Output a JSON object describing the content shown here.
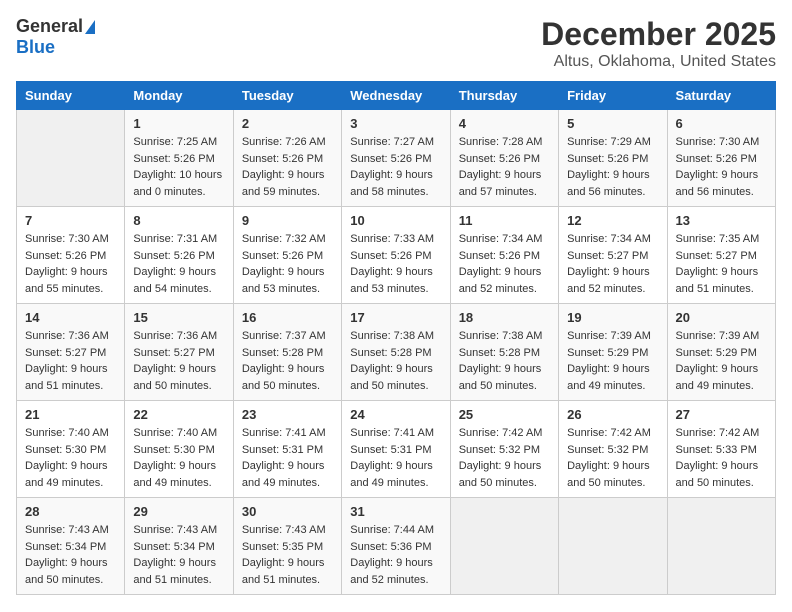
{
  "logo": {
    "general": "General",
    "blue": "Blue"
  },
  "title": "December 2025",
  "subtitle": "Altus, Oklahoma, United States",
  "days_of_week": [
    "Sunday",
    "Monday",
    "Tuesday",
    "Wednesday",
    "Thursday",
    "Friday",
    "Saturday"
  ],
  "weeks": [
    [
      {
        "day": "",
        "info": ""
      },
      {
        "day": "1",
        "info": "Sunrise: 7:25 AM\nSunset: 5:26 PM\nDaylight: 10 hours\nand 0 minutes."
      },
      {
        "day": "2",
        "info": "Sunrise: 7:26 AM\nSunset: 5:26 PM\nDaylight: 9 hours\nand 59 minutes."
      },
      {
        "day": "3",
        "info": "Sunrise: 7:27 AM\nSunset: 5:26 PM\nDaylight: 9 hours\nand 58 minutes."
      },
      {
        "day": "4",
        "info": "Sunrise: 7:28 AM\nSunset: 5:26 PM\nDaylight: 9 hours\nand 57 minutes."
      },
      {
        "day": "5",
        "info": "Sunrise: 7:29 AM\nSunset: 5:26 PM\nDaylight: 9 hours\nand 56 minutes."
      },
      {
        "day": "6",
        "info": "Sunrise: 7:30 AM\nSunset: 5:26 PM\nDaylight: 9 hours\nand 56 minutes."
      }
    ],
    [
      {
        "day": "7",
        "info": "Sunrise: 7:30 AM\nSunset: 5:26 PM\nDaylight: 9 hours\nand 55 minutes."
      },
      {
        "day": "8",
        "info": "Sunrise: 7:31 AM\nSunset: 5:26 PM\nDaylight: 9 hours\nand 54 minutes."
      },
      {
        "day": "9",
        "info": "Sunrise: 7:32 AM\nSunset: 5:26 PM\nDaylight: 9 hours\nand 53 minutes."
      },
      {
        "day": "10",
        "info": "Sunrise: 7:33 AM\nSunset: 5:26 PM\nDaylight: 9 hours\nand 53 minutes."
      },
      {
        "day": "11",
        "info": "Sunrise: 7:34 AM\nSunset: 5:26 PM\nDaylight: 9 hours\nand 52 minutes."
      },
      {
        "day": "12",
        "info": "Sunrise: 7:34 AM\nSunset: 5:27 PM\nDaylight: 9 hours\nand 52 minutes."
      },
      {
        "day": "13",
        "info": "Sunrise: 7:35 AM\nSunset: 5:27 PM\nDaylight: 9 hours\nand 51 minutes."
      }
    ],
    [
      {
        "day": "14",
        "info": "Sunrise: 7:36 AM\nSunset: 5:27 PM\nDaylight: 9 hours\nand 51 minutes."
      },
      {
        "day": "15",
        "info": "Sunrise: 7:36 AM\nSunset: 5:27 PM\nDaylight: 9 hours\nand 50 minutes."
      },
      {
        "day": "16",
        "info": "Sunrise: 7:37 AM\nSunset: 5:28 PM\nDaylight: 9 hours\nand 50 minutes."
      },
      {
        "day": "17",
        "info": "Sunrise: 7:38 AM\nSunset: 5:28 PM\nDaylight: 9 hours\nand 50 minutes."
      },
      {
        "day": "18",
        "info": "Sunrise: 7:38 AM\nSunset: 5:28 PM\nDaylight: 9 hours\nand 50 minutes."
      },
      {
        "day": "19",
        "info": "Sunrise: 7:39 AM\nSunset: 5:29 PM\nDaylight: 9 hours\nand 49 minutes."
      },
      {
        "day": "20",
        "info": "Sunrise: 7:39 AM\nSunset: 5:29 PM\nDaylight: 9 hours\nand 49 minutes."
      }
    ],
    [
      {
        "day": "21",
        "info": "Sunrise: 7:40 AM\nSunset: 5:30 PM\nDaylight: 9 hours\nand 49 minutes."
      },
      {
        "day": "22",
        "info": "Sunrise: 7:40 AM\nSunset: 5:30 PM\nDaylight: 9 hours\nand 49 minutes."
      },
      {
        "day": "23",
        "info": "Sunrise: 7:41 AM\nSunset: 5:31 PM\nDaylight: 9 hours\nand 49 minutes."
      },
      {
        "day": "24",
        "info": "Sunrise: 7:41 AM\nSunset: 5:31 PM\nDaylight: 9 hours\nand 49 minutes."
      },
      {
        "day": "25",
        "info": "Sunrise: 7:42 AM\nSunset: 5:32 PM\nDaylight: 9 hours\nand 50 minutes."
      },
      {
        "day": "26",
        "info": "Sunrise: 7:42 AM\nSunset: 5:32 PM\nDaylight: 9 hours\nand 50 minutes."
      },
      {
        "day": "27",
        "info": "Sunrise: 7:42 AM\nSunset: 5:33 PM\nDaylight: 9 hours\nand 50 minutes."
      }
    ],
    [
      {
        "day": "28",
        "info": "Sunrise: 7:43 AM\nSunset: 5:34 PM\nDaylight: 9 hours\nand 50 minutes."
      },
      {
        "day": "29",
        "info": "Sunrise: 7:43 AM\nSunset: 5:34 PM\nDaylight: 9 hours\nand 51 minutes."
      },
      {
        "day": "30",
        "info": "Sunrise: 7:43 AM\nSunset: 5:35 PM\nDaylight: 9 hours\nand 51 minutes."
      },
      {
        "day": "31",
        "info": "Sunrise: 7:44 AM\nSunset: 5:36 PM\nDaylight: 9 hours\nand 52 minutes."
      },
      {
        "day": "",
        "info": ""
      },
      {
        "day": "",
        "info": ""
      },
      {
        "day": "",
        "info": ""
      }
    ]
  ]
}
